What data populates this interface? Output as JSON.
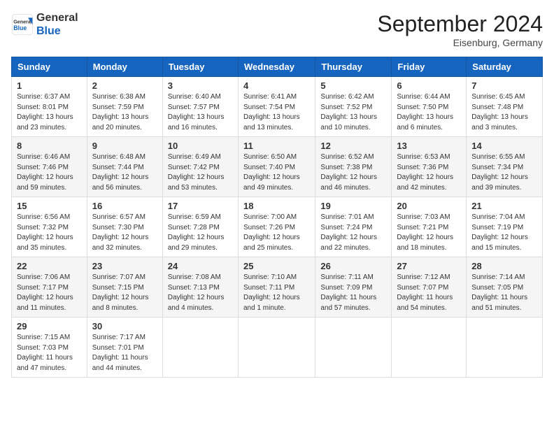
{
  "header": {
    "logo_general": "General",
    "logo_blue": "Blue",
    "month_title": "September 2024",
    "location": "Eisenburg, Germany"
  },
  "days_of_week": [
    "Sunday",
    "Monday",
    "Tuesday",
    "Wednesday",
    "Thursday",
    "Friday",
    "Saturday"
  ],
  "weeks": [
    [
      {
        "day": "1",
        "sunrise": "6:37 AM",
        "sunset": "8:01 PM",
        "daylight": "13 hours and 23 minutes."
      },
      {
        "day": "2",
        "sunrise": "6:38 AM",
        "sunset": "7:59 PM",
        "daylight": "13 hours and 20 minutes."
      },
      {
        "day": "3",
        "sunrise": "6:40 AM",
        "sunset": "7:57 PM",
        "daylight": "13 hours and 16 minutes."
      },
      {
        "day": "4",
        "sunrise": "6:41 AM",
        "sunset": "7:54 PM",
        "daylight": "13 hours and 13 minutes."
      },
      {
        "day": "5",
        "sunrise": "6:42 AM",
        "sunset": "7:52 PM",
        "daylight": "13 hours and 10 minutes."
      },
      {
        "day": "6",
        "sunrise": "6:44 AM",
        "sunset": "7:50 PM",
        "daylight": "13 hours and 6 minutes."
      },
      {
        "day": "7",
        "sunrise": "6:45 AM",
        "sunset": "7:48 PM",
        "daylight": "13 hours and 3 minutes."
      }
    ],
    [
      {
        "day": "8",
        "sunrise": "6:46 AM",
        "sunset": "7:46 PM",
        "daylight": "12 hours and 59 minutes."
      },
      {
        "day": "9",
        "sunrise": "6:48 AM",
        "sunset": "7:44 PM",
        "daylight": "12 hours and 56 minutes."
      },
      {
        "day": "10",
        "sunrise": "6:49 AM",
        "sunset": "7:42 PM",
        "daylight": "12 hours and 53 minutes."
      },
      {
        "day": "11",
        "sunrise": "6:50 AM",
        "sunset": "7:40 PM",
        "daylight": "12 hours and 49 minutes."
      },
      {
        "day": "12",
        "sunrise": "6:52 AM",
        "sunset": "7:38 PM",
        "daylight": "12 hours and 46 minutes."
      },
      {
        "day": "13",
        "sunrise": "6:53 AM",
        "sunset": "7:36 PM",
        "daylight": "12 hours and 42 minutes."
      },
      {
        "day": "14",
        "sunrise": "6:55 AM",
        "sunset": "7:34 PM",
        "daylight": "12 hours and 39 minutes."
      }
    ],
    [
      {
        "day": "15",
        "sunrise": "6:56 AM",
        "sunset": "7:32 PM",
        "daylight": "12 hours and 35 minutes."
      },
      {
        "day": "16",
        "sunrise": "6:57 AM",
        "sunset": "7:30 PM",
        "daylight": "12 hours and 32 minutes."
      },
      {
        "day": "17",
        "sunrise": "6:59 AM",
        "sunset": "7:28 PM",
        "daylight": "12 hours and 29 minutes."
      },
      {
        "day": "18",
        "sunrise": "7:00 AM",
        "sunset": "7:26 PM",
        "daylight": "12 hours and 25 minutes."
      },
      {
        "day": "19",
        "sunrise": "7:01 AM",
        "sunset": "7:24 PM",
        "daylight": "12 hours and 22 minutes."
      },
      {
        "day": "20",
        "sunrise": "7:03 AM",
        "sunset": "7:21 PM",
        "daylight": "12 hours and 18 minutes."
      },
      {
        "day": "21",
        "sunrise": "7:04 AM",
        "sunset": "7:19 PM",
        "daylight": "12 hours and 15 minutes."
      }
    ],
    [
      {
        "day": "22",
        "sunrise": "7:06 AM",
        "sunset": "7:17 PM",
        "daylight": "12 hours and 11 minutes."
      },
      {
        "day": "23",
        "sunrise": "7:07 AM",
        "sunset": "7:15 PM",
        "daylight": "12 hours and 8 minutes."
      },
      {
        "day": "24",
        "sunrise": "7:08 AM",
        "sunset": "7:13 PM",
        "daylight": "12 hours and 4 minutes."
      },
      {
        "day": "25",
        "sunrise": "7:10 AM",
        "sunset": "7:11 PM",
        "daylight": "12 hours and 1 minute."
      },
      {
        "day": "26",
        "sunrise": "7:11 AM",
        "sunset": "7:09 PM",
        "daylight": "11 hours and 57 minutes."
      },
      {
        "day": "27",
        "sunrise": "7:12 AM",
        "sunset": "7:07 PM",
        "daylight": "11 hours and 54 minutes."
      },
      {
        "day": "28",
        "sunrise": "7:14 AM",
        "sunset": "7:05 PM",
        "daylight": "11 hours and 51 minutes."
      }
    ],
    [
      {
        "day": "29",
        "sunrise": "7:15 AM",
        "sunset": "7:03 PM",
        "daylight": "11 hours and 47 minutes."
      },
      {
        "day": "30",
        "sunrise": "7:17 AM",
        "sunset": "7:01 PM",
        "daylight": "11 hours and 44 minutes."
      },
      null,
      null,
      null,
      null,
      null
    ]
  ]
}
